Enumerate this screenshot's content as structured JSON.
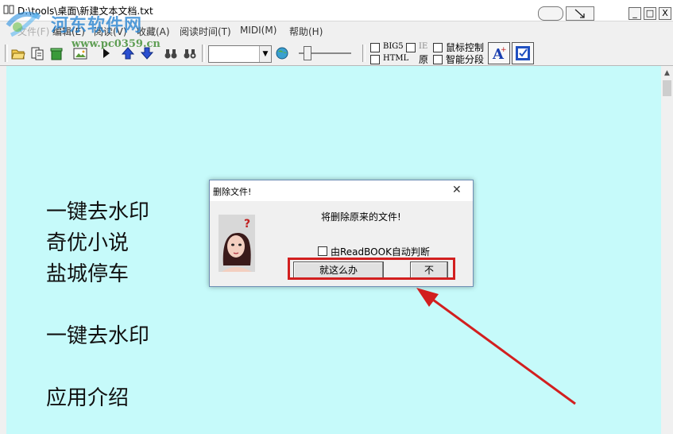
{
  "window": {
    "title": "D:\\tools\\桌面\\新建文本文档.txt",
    "minimize_glyph": "_",
    "maximize_glyph": "□",
    "close_glyph": "X"
  },
  "watermark": {
    "name": "河东软件网",
    "url": "www.pc0359.cn"
  },
  "menu": {
    "items": [
      "编辑(E)",
      "阅读(V)",
      "收藏(A)",
      "阅读时间(T)",
      "MIDI(M)",
      "帮助(H)"
    ],
    "partial_item": "文件(F)"
  },
  "toolbar": {
    "combo_value": "",
    "checkboxes": {
      "big5": "BIG5",
      "html": "HTML",
      "ie": "IE",
      "yuan": "原",
      "mouse_control": "鼠标控制",
      "smart_paragraph": "智能分段"
    }
  },
  "document": {
    "lines": [
      "一键去水印",
      "奇优小说",
      "盐城停车",
      "一键去水印",
      "应用介绍"
    ]
  },
  "dialog": {
    "title": "删除文件!",
    "close_glyph": "✕",
    "message": "将删除原来的文件!",
    "checkbox_label": "由ReadBOOK自动判断",
    "confirm_label": "就这么办",
    "cancel_label": "不"
  },
  "colors": {
    "content_bg": "#c6fafa",
    "highlight": "#d21f1f",
    "watermark_blue": "#1e7fd1"
  }
}
